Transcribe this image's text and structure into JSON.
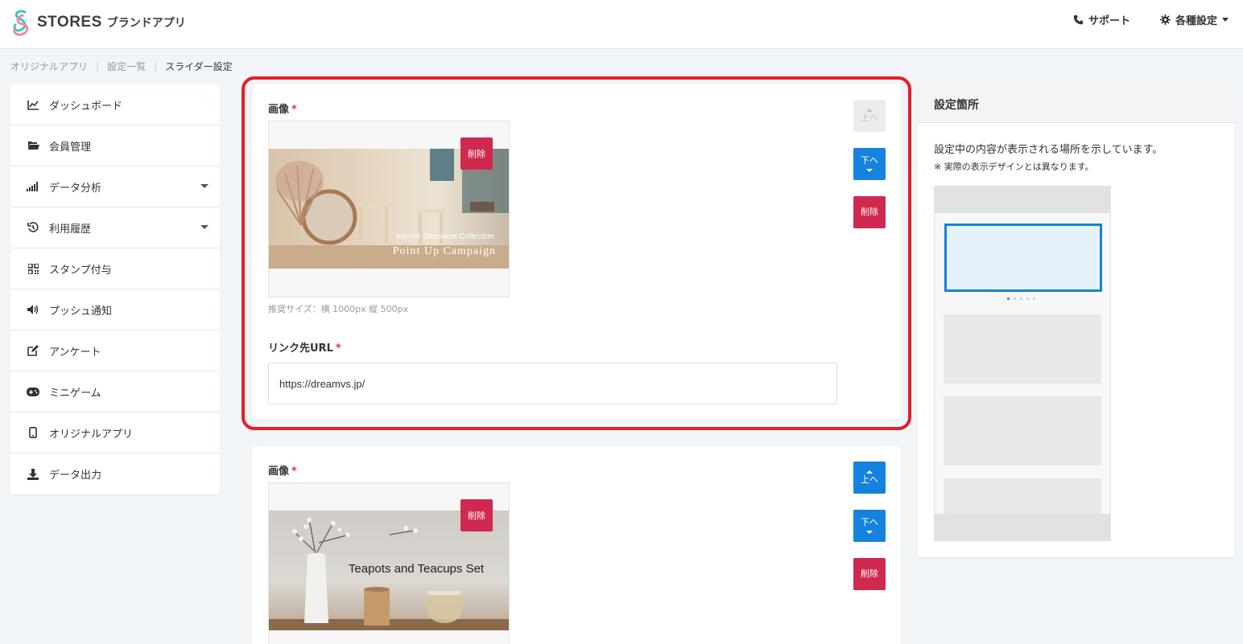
{
  "header": {
    "logo_text": "STORES",
    "logo_sub": "ブランドアプリ",
    "support": "サポート",
    "settings": "各種設定"
  },
  "breadcrumb": [
    "オリジナルアプリ",
    "設定一覧",
    "スライダー設定"
  ],
  "sidebar": {
    "items": [
      {
        "label": "ダッシュボード",
        "icon": "chart-line-icon"
      },
      {
        "label": "会員管理",
        "icon": "folder-open-icon"
      },
      {
        "label": "データ分析",
        "icon": "signal-bars-icon"
      },
      {
        "label": "利用履歴",
        "icon": "history-icon"
      },
      {
        "label": "スタンプ付与",
        "icon": "qrcode-icon"
      },
      {
        "label": "プッシュ通知",
        "icon": "volume-icon"
      },
      {
        "label": "アンケート",
        "icon": "edit-icon"
      },
      {
        "label": "ミニゲーム",
        "icon": "gamepad-icon"
      },
      {
        "label": "オリジナルアプリ",
        "icon": "mobile-icon"
      },
      {
        "label": "データ出力",
        "icon": "download-icon"
      }
    ]
  },
  "slides": [
    {
      "image_label": "画像",
      "required_mark": "*",
      "image_text_line1": "Interior Seasonal Collection",
      "image_text_line2": "Point Up Campaign",
      "delete_small": "削除",
      "hint": "推奨サイズ：横 1000px 縦 500px",
      "url_label": "リンク先URL",
      "url_value": "https://dreamvs.jp/",
      "up": "上へ",
      "down": "下へ",
      "delete": "削除"
    },
    {
      "image_label": "画像",
      "required_mark": "*",
      "image_text_line1": "Teapots and Teacups Set",
      "delete_small": "削除",
      "up": "上へ",
      "down": "下へ",
      "delete": "削除"
    }
  ],
  "panel": {
    "title": "設定箇所",
    "desc": "設定中の内容が表示される場所を示しています。",
    "note": "※ 実際の表示デザインとは異なります。"
  },
  "colors": {
    "accent_blue": "#1482de",
    "danger_red": "#d0294f",
    "highlight_red": "#e51d2a"
  }
}
